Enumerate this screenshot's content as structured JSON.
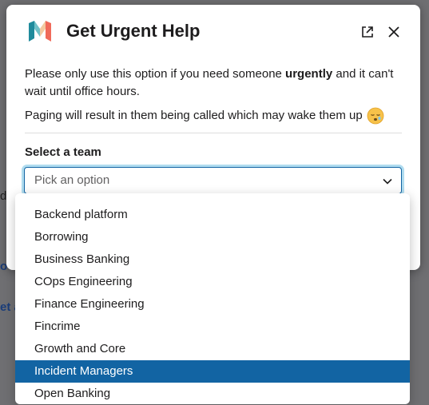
{
  "dialog": {
    "title": "Get Urgent Help",
    "intro_before": "Please only use this option if you need someone ",
    "intro_bold": "urgently",
    "intro_after": " and it can't wait until office hours.",
    "paging_note": "Paging will result in them being called which may wake them up"
  },
  "team_select": {
    "label": "Select a team",
    "placeholder": "Pick an option",
    "options": [
      "Backend platform",
      "Borrowing",
      "Business Banking",
      "COps Engineering",
      "Finance Engineering",
      "Fincrime",
      "Growth and Core",
      "Incident Managers",
      "Open Banking"
    ],
    "highlighted": "Incident Managers"
  },
  "icons": {
    "logo": "monzo-m-logo",
    "open_external": "external-link-icon",
    "close": "close-icon",
    "chevron": "chevron-down-icon",
    "emoji": "sleeping-face-emoji"
  },
  "colors": {
    "accent": "#1264a3",
    "backdrop": "#6f6f72",
    "text": "#1d1c1d"
  }
}
